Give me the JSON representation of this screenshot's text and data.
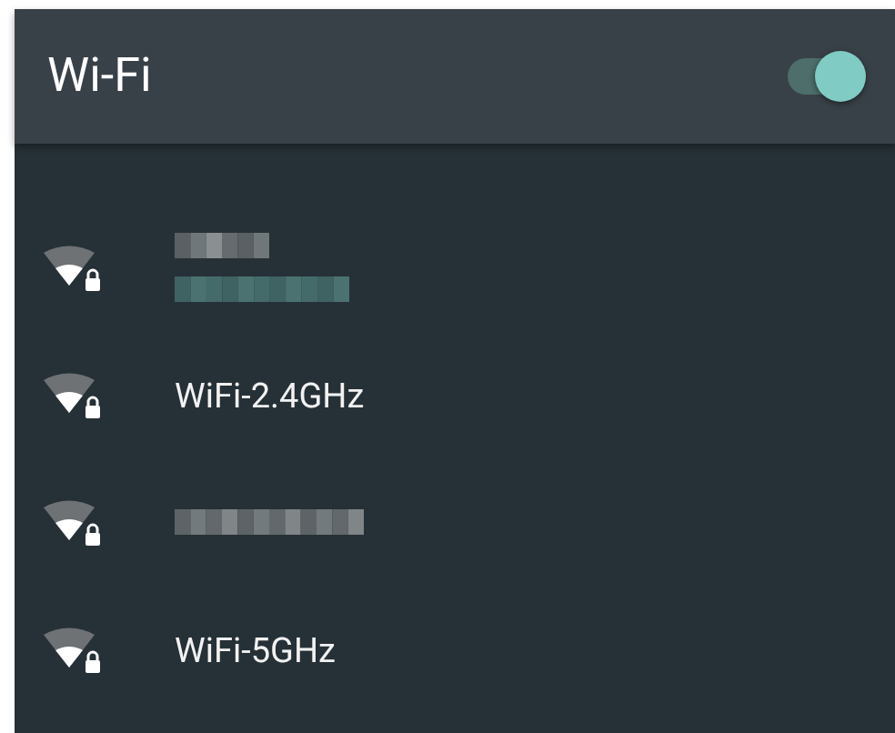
{
  "header": {
    "title": "Wi-Fi",
    "toggle": {
      "on": true
    }
  },
  "networks": [
    {
      "kind": "obscured-two-line"
    },
    {
      "kind": "named",
      "name": "WiFi-2.4GHz"
    },
    {
      "kind": "obscured"
    },
    {
      "kind": "named",
      "name": "WiFi-5GHz"
    }
  ]
}
